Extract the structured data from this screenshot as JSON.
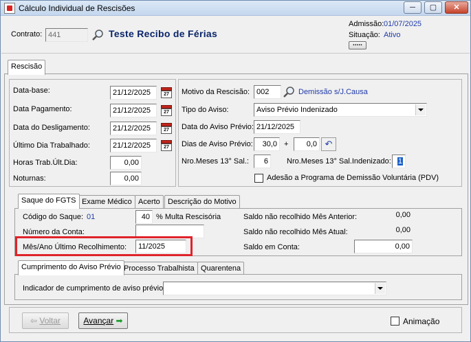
{
  "window": {
    "title": "Cálculo Individual de Rescisões",
    "minimize": "─",
    "maximize": "▢",
    "close": "✕"
  },
  "header": {
    "contrato_label": "Contrato:",
    "contrato_value": "441",
    "recibo_title": "Teste Recibo de Férias",
    "admissao_label": "Admissão:",
    "admissao_value": "01/07/2025",
    "situacao_label": "Situação:",
    "situacao_value": "Ativo",
    "more_button": "....."
  },
  "main_tab": {
    "label": "Rescisão"
  },
  "dates": {
    "data_base_label": "Data-base:",
    "data_base_value": "21/12/2025",
    "data_pagamento_label": "Data Pagamento:",
    "data_pagamento_value": "21/12/2025",
    "data_desligamento_label": "Data do Desligamento:",
    "data_desligamento_value": "21/12/2025",
    "ultimo_dia_label": "Último Dia Trabalhado:",
    "ultimo_dia_value": "21/12/2025",
    "horas_label": "Horas Trab.Últ.Dia:",
    "horas_value": "0,00",
    "noturnas_label": "Noturnas:",
    "noturnas_value": "0,00",
    "cal_glyph": "27"
  },
  "rescisao": {
    "motivo_label": "Motivo da Rescisão:",
    "motivo_code": "002",
    "motivo_desc": "Demissão s/J.Causa",
    "tipo_aviso_label": "Tipo do Aviso:",
    "tipo_aviso_value": "Aviso Prévio Indenizado",
    "data_aviso_label": "Data do Aviso Prévio:",
    "data_aviso_value": "21/12/2025",
    "dias_aviso_label": "Dias de Aviso Prévio:",
    "dias_aviso_value": "30,0",
    "dias_plus": "+",
    "dias_extra_value": "0,0",
    "undo_glyph": "↶",
    "meses_13_label": "Nro.Meses 13° Sal.:",
    "meses_13_value": "6",
    "meses_13_ind_label": "Nro.Meses 13° Sal.Indenizado:",
    "meses_13_ind_value": "1",
    "pdv_label": "Adesão a Programa de Demissão Voluntária (PDV)"
  },
  "sub_tabs": [
    "Saque do FGTS",
    "Exame Médico",
    "Acerto",
    "Descrição do Motivo"
  ],
  "fgts": {
    "codigo_label": "Código do Saque:",
    "codigo_value": "01",
    "multa_value": "40",
    "multa_label": "% Multa Rescisória",
    "numero_conta_label": "Número da Conta:",
    "numero_conta_value": "",
    "mes_ano_label": "Mês/Ano Último Recolhimento:",
    "mes_ano_value": "11/2025",
    "saldo_anterior_label": "Saldo não recolhido Mês Anterior:",
    "saldo_anterior_value": "0,00",
    "saldo_atual_label": "Saldo não recolhido Mês Atual:",
    "saldo_atual_value": "0,00",
    "saldo_conta_label": "Saldo em Conta:",
    "saldo_conta_value": "0,00"
  },
  "aviso_tabs": [
    "Cumprimento do Aviso Prévio",
    "Processo Trabalhista",
    "Quarentena"
  ],
  "aviso": {
    "indicador_label": "Indicador de cumprimento de aviso prévio:",
    "indicador_value": ""
  },
  "footer": {
    "voltar_label": "Voltar",
    "voltar_icon": "⇦",
    "avancar_label": "Avançar",
    "avancar_icon": "➡",
    "animacao_label": "Animação"
  },
  "colors": {
    "highlight": "#e0232a",
    "link_blue": "#1f3aa8",
    "title_blue": "#0a246a"
  }
}
